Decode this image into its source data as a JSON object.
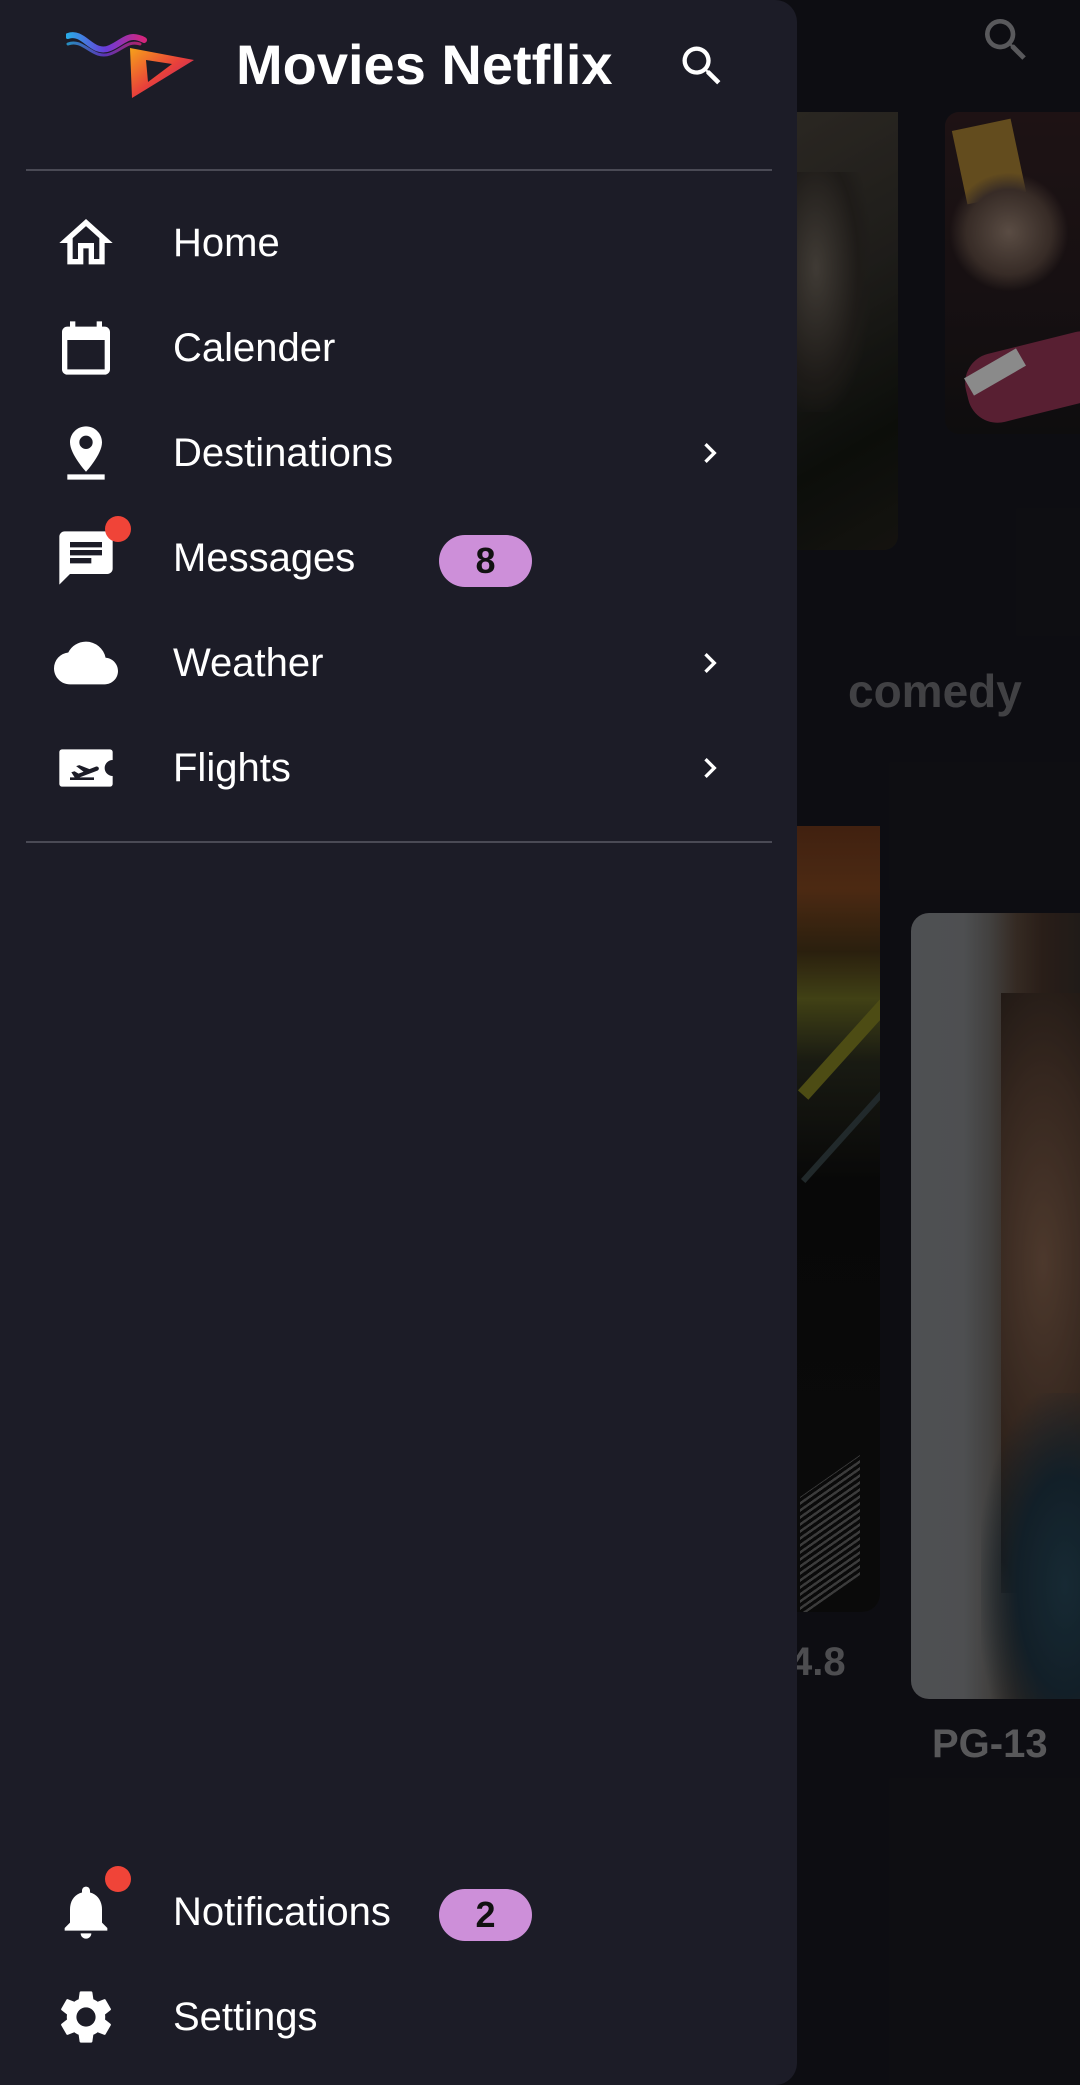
{
  "app": {
    "title": "Movies Netflix"
  },
  "drawer": {
    "items": [
      {
        "label": "Home",
        "icon": "home-icon"
      },
      {
        "label": "Calender",
        "icon": "calendar-icon"
      },
      {
        "label": "Destinations",
        "icon": "location-pin-icon",
        "has_submenu": true
      },
      {
        "label": "Messages",
        "icon": "chat-icon",
        "badge": "8",
        "has_dot": true
      },
      {
        "label": "Weather",
        "icon": "cloud-icon",
        "has_submenu": true
      },
      {
        "label": "Flights",
        "icon": "flight-ticket-icon",
        "has_submenu": true
      }
    ],
    "footer_items": [
      {
        "label": "Notifications",
        "icon": "bell-icon",
        "badge": "2",
        "has_dot": true
      },
      {
        "label": "Settings",
        "icon": "gear-icon"
      }
    ]
  },
  "background": {
    "genre_label": "comedy",
    "rating": "4.8",
    "age_rating": "PG-13"
  },
  "colors": {
    "drawer_bg": "#1c1c27",
    "badge_bg": "#cd8fd9",
    "dot": "#f04438",
    "app_bg": "#131319"
  }
}
